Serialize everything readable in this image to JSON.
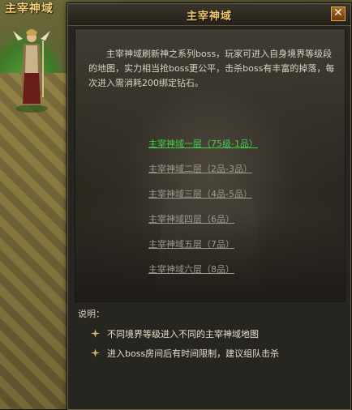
{
  "scene": {
    "npc_title": "主宰神域"
  },
  "dialog": {
    "title": "主宰神域",
    "close_label": "✕",
    "description": "主宰神域刷新神之系列boss，玩家可进入自身境界等级段的地图，实力相当抢boss更公平，击杀boss有丰富的掉落，每次进入需消耗200绑定钻石。",
    "floors": [
      "主宰神域一层（75级-1品）",
      "主宰神域二层（2品-3品）",
      "主宰神域三层（4品-5品）",
      "主宰神域四层（6品）",
      "主宰神域五层（7品）",
      "主宰神域六层（8品）"
    ],
    "notes_label": "说明：",
    "notes": [
      "不同境界等级进入不同的主宰神域地图",
      "进入boss房间后有时间限制，建议组队击杀"
    ]
  },
  "colors": {
    "title_gold": "#f0c86a",
    "active_link": "#42d04a",
    "inactive_link": "#9e9a8c"
  }
}
